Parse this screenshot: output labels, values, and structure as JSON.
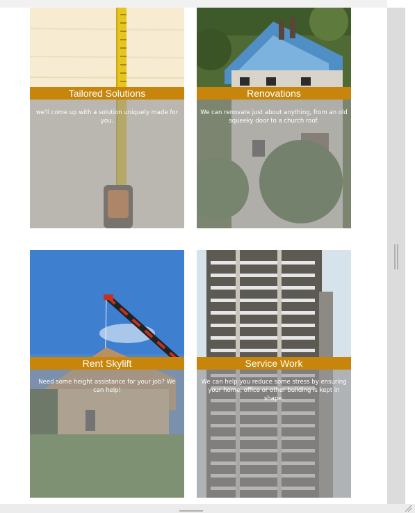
{
  "services": [
    {
      "title": "Tailored Solutions",
      "description": "we'll come up with a solution uniquely made for you.",
      "image": "measuring-tape-photo"
    },
    {
      "title": "Renovations",
      "description": "We can renovate just about anything, from an old squeeky door to a church roof.",
      "image": "house-roof-renovation-photo"
    },
    {
      "title": "Rent Skylift",
      "description": "Need some height assistance for your job? We can help!",
      "image": "skylift-crane-photo"
    },
    {
      "title": "Service Work",
      "description": "We can help you reduce some stress by ensuring your home, office or other building is kept in shape.",
      "image": "apartment-tower-photo"
    }
  ],
  "colors": {
    "title_band": "#c7860b",
    "overlay": "#969696",
    "scrollbar_track": "#dcdcdc"
  }
}
